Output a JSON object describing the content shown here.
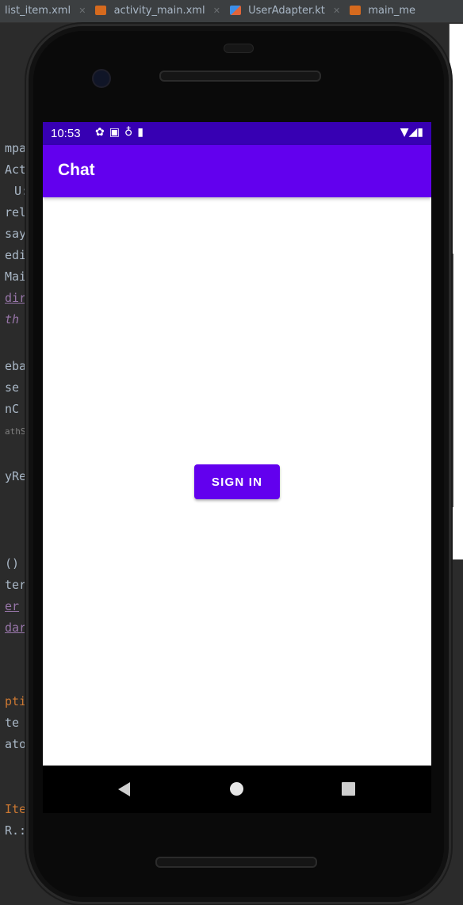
{
  "ide": {
    "tabs": [
      {
        "label": "list_item.xml",
        "type": "xml"
      },
      {
        "label": "activity_main.xml",
        "type": "xml"
      },
      {
        "label": "UserAdapter.kt",
        "type": "kt"
      },
      {
        "label": "main_me",
        "type": "xml"
      }
    ],
    "code_fragments": [
      "mpa",
      "Act",
      "U:",
      "rel",
      "say",
      "edi",
      "Mai",
      "dir",
      "th",
      "eba",
      "se",
      "nC",
      "athS",
      "yRe",
      "()",
      "ter",
      "er",
      "dar",
      "pti",
      "te",
      "ato",
      "Ite",
      "R.:"
    ]
  },
  "colors": {
    "status_bar": "#3700b3",
    "app_bar": "#6200ee",
    "button": "#6200ee"
  },
  "phone": {
    "status_bar": {
      "time": "10:53",
      "left_icons": [
        "gear-icon",
        "gmail-icon",
        "download-icon",
        "sd-card-icon"
      ],
      "right_icons": [
        "wifi-icon",
        "signal-icon",
        "battery-icon"
      ]
    },
    "app_bar": {
      "title": "Chat"
    },
    "content": {
      "sign_in_button": "SIGN IN"
    },
    "nav": [
      "back-icon",
      "home-icon",
      "recents-icon"
    ]
  }
}
